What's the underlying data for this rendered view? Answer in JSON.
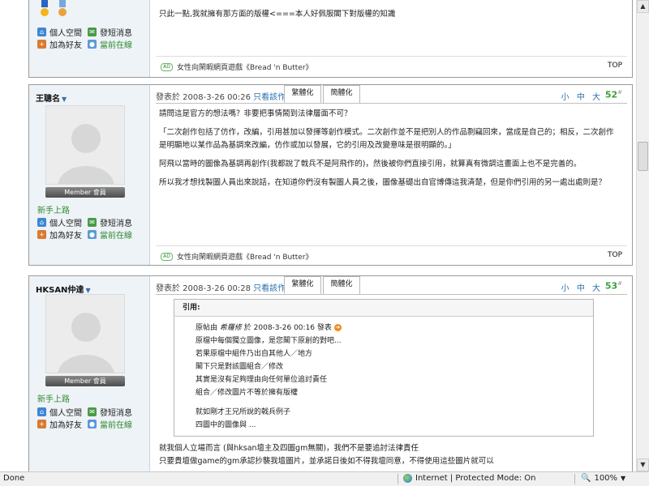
{
  "posts": [
    {
      "actions": {
        "profile": "個人空間",
        "message": "發短消息",
        "add_friend": "加為好友",
        "online": "當前在線"
      },
      "body": [
        "只此一點,我就擁有那方面的版權<===本人好佩服閣下對版權的知識"
      ],
      "signature": "女性向閑暇網頁遊戲《Bread 'n Butter》",
      "top": "TOP"
    },
    {
      "author": "王聰名",
      "rank": "新手上路",
      "badge": "Member 會員",
      "actions": {
        "profile": "個人空間",
        "message": "發短消息",
        "add_friend": "加為好友",
        "online": "當前在線"
      },
      "meta": "發表於 2008-3-26 00:26",
      "only_author": "只看該作者",
      "tab_trad": "繁體化",
      "tab_simp": "簡體化",
      "sizes": "小 中 大",
      "number": "52",
      "body": [
        "請問這是官方的想法嗎？非要把事情鬧到法律層面不可？",
        "「二次創作包括了仿作，改編，引用甚加以發揮等創作模式。二次創作並不是把別人的作品剽竊回來，當成是自己的；相反，二次創作是明顯地以某作品為基調來改編，仿作或加以發展，它的引用及改變意味是很明顯的。」",
        "阿飛以當時的圖像為基調再創作(我都說了戟兵不是阿飛作的)，然後被你們直接引用，就算真有微調這畫面上也不是完善的。",
        "所以我才想找製圖人員出來說話，在知道你們沒有製圖人員之後，圖像基礎出自官博傳這我清楚，但是你們引用的另一處出處則是？"
      ],
      "signature": "女性向閑暇網頁遊戲《Bread 'n Butter》",
      "top": "TOP"
    },
    {
      "author": "HKSAN仲達",
      "rank": "新手上路",
      "badge": "Member 會員",
      "actions": {
        "profile": "個人空間",
        "message": "發短消息",
        "add_friend": "加為好友",
        "online": "當前在線"
      },
      "meta": "發表於 2008-3-26 00:28",
      "only_author": "只看該作者",
      "tab_trad": "繁體化",
      "tab_simp": "簡體化",
      "sizes": "小 中 大",
      "number": "53",
      "quote": {
        "title": "引用:",
        "header_prefix": "原帖由",
        "header_author": "希羅修",
        "header_suffix": "於 2008-3-26 00:16 發表",
        "lines": [
          "原檔中每個獨立圖像，是您閣下原創的對吧...",
          "若果原檔中組件乃出自其他人／地方",
          "閣下只是對該圖組合／修改",
          "其實是沒有足夠理由向任何單位追討責任",
          "組合／修改圖片不等於擁有版權",
          "",
          "就如剛才王兄所說的戟兵例子",
          "四圖中的圖像與 ..."
        ]
      },
      "body": [
        "就我個人立場而言 (與hksan壇主及四圖gm無關)，我們不是要追討法律責任",
        "只要貴壇做game的gm承認抄襲我壇圖片，並承諾日後如不得我壇同意，不得使用這些圖片就可以"
      ]
    }
  ],
  "statusbar": {
    "done": "Done",
    "zone": "Internet | Protected Mode: On",
    "zoom": "100%"
  },
  "icons": {
    "profile": "home-icon",
    "message": "message-icon",
    "add_friend": "add-friend-icon",
    "online": "online-user-icon"
  }
}
